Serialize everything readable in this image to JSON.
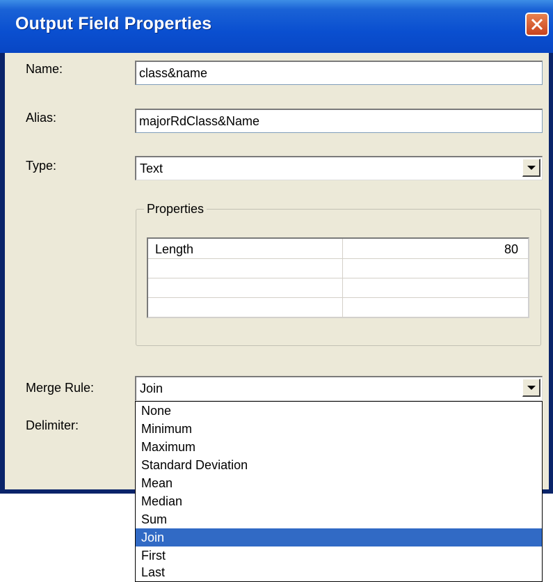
{
  "window": {
    "title": "Output Field Properties"
  },
  "fields": {
    "name_label": "Name:",
    "name_value": "class&name",
    "alias_label": "Alias:",
    "alias_value": "majorRdClass&Name",
    "type_label": "Type:",
    "type_value": "Text",
    "merge_label": "Merge Rule:",
    "merge_value": "Join",
    "delimiter_label": "Delimiter:"
  },
  "properties": {
    "title": "Properties",
    "rows": [
      {
        "key": "Length",
        "value": "80"
      },
      {
        "key": "",
        "value": ""
      },
      {
        "key": "",
        "value": ""
      },
      {
        "key": "",
        "value": ""
      }
    ]
  },
  "merge_options": [
    "None",
    "Minimum",
    "Maximum",
    "Standard Deviation",
    "Mean",
    "Median",
    "Sum",
    "Join",
    "First",
    "Last"
  ],
  "selected_merge_option": "Join",
  "colors": {
    "titlebar": "#0a4fd0",
    "dialog_bg": "#ece9d8",
    "selection": "#316ac5",
    "close_button": "#c8431f"
  }
}
